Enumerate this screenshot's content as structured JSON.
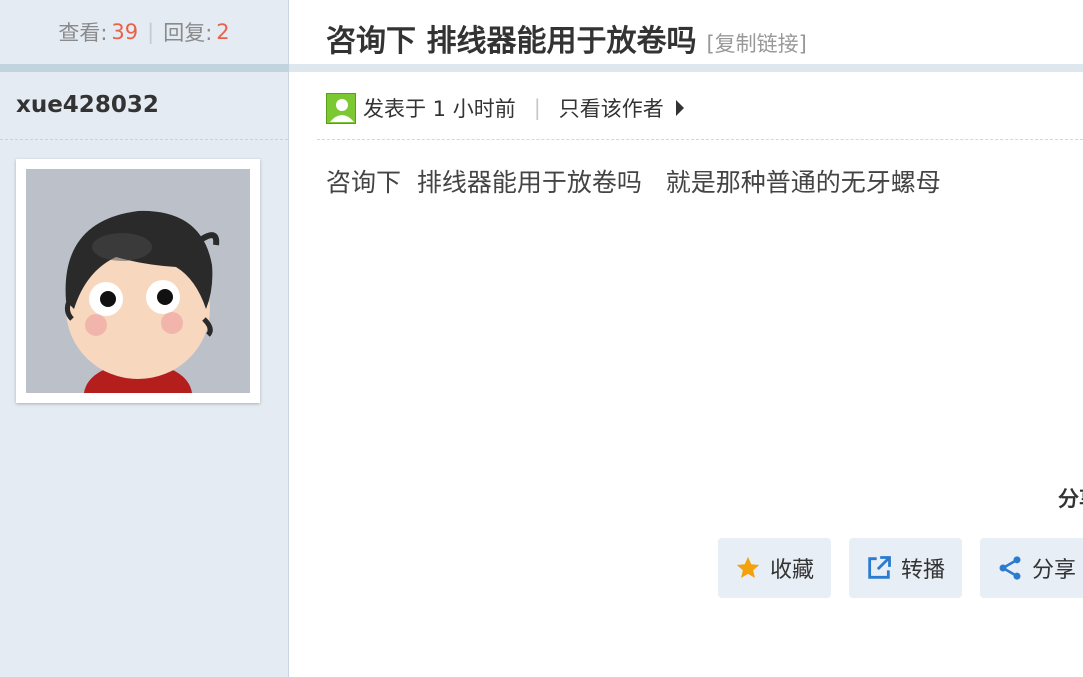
{
  "thread": {
    "views_label": "查看:",
    "views": "39",
    "separator": "|",
    "replies_label": "回复:",
    "replies": "2",
    "title": "咨询下 排线器能用于放卷吗",
    "copy_link": "[复制链接]"
  },
  "author": {
    "name": "xue428032"
  },
  "post": {
    "posted_time": "发表于 1 小时前",
    "separator": "|",
    "only_author": "只看该作者",
    "content": "咨询下  排线器能用于放卷吗   就是那种普通的无牙螺母"
  },
  "share_fragment": "分享",
  "actions": {
    "favorite": "收藏",
    "repost": "转播",
    "share": "分享"
  },
  "colors": {
    "sidebar_bg": "#e4ebf2",
    "stat_number": "#e8624a",
    "button_bg": "#e8eef5",
    "star": "#f5a10c",
    "action_icon": "#2b7bd0",
    "online_icon": "#7cc832"
  }
}
